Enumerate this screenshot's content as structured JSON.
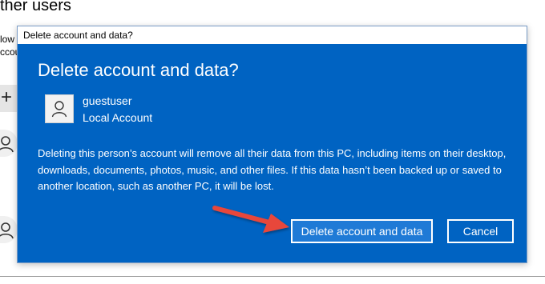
{
  "background": {
    "heading": "ther users",
    "text_line1": "low",
    "text_line2": "ccou",
    "add_symbol": "+"
  },
  "dialog": {
    "window_title": "Delete account and data?",
    "heading": "Delete account and data?",
    "account": {
      "name": "guestuser",
      "type": "Local Account",
      "icon": "person-icon"
    },
    "message": "Deleting this person’s account will remove all their data from this PC, including items on their desktop, downloads, documents, photos, music, and other files. If this data hasn’t been backed up or saved to another location, such as another PC, it will be lost.",
    "buttons": {
      "primary_label": "Delete account and data",
      "cancel_label": "Cancel"
    },
    "colors": {
      "dialog_bg": "#0063c2",
      "primary_btn_bg": "#1f7ad6",
      "arrow": "#e8473a"
    }
  }
}
